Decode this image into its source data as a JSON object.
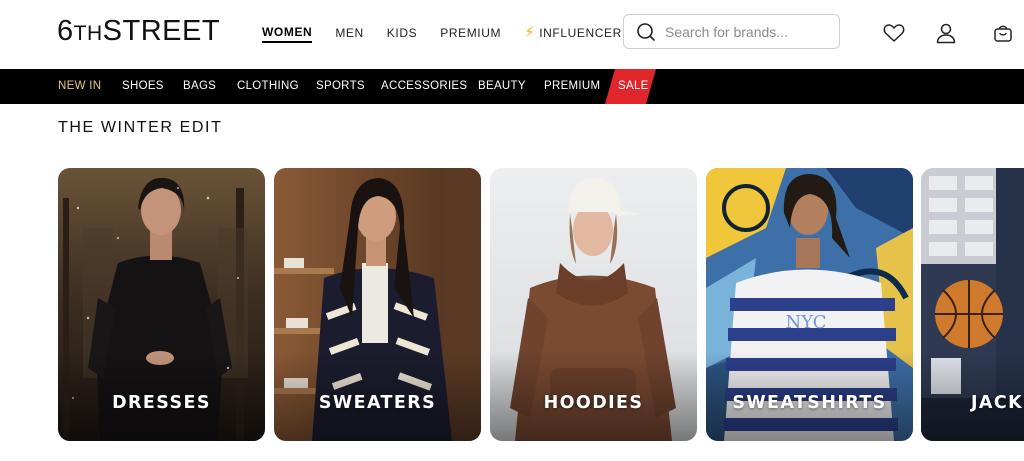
{
  "brand": {
    "logo_big1": "6",
    "logo_small": "TH",
    "logo_big2": "STREET"
  },
  "top_nav": {
    "items": [
      {
        "label": "WOMEN",
        "active": true
      },
      {
        "label": "MEN"
      },
      {
        "label": "KIDS"
      },
      {
        "label": "PREMIUM"
      },
      {
        "label": "INFLUENCER",
        "icon": "lightning-icon"
      }
    ]
  },
  "search": {
    "placeholder": "Search for brands..."
  },
  "header_icons": [
    "heart-icon",
    "user-icon",
    "bag-icon"
  ],
  "category_bar": {
    "items": [
      "NEW IN",
      "SHOES",
      "BAGS",
      "CLOTHING",
      "SPORTS",
      "ACCESSORIES",
      "BEAUTY",
      "PREMIUM",
      "SALE"
    ],
    "new_in_color": "#e8c977",
    "sale_color": "#e0262b"
  },
  "section": {
    "title": "THE WINTER EDIT",
    "cards": [
      {
        "label": "DRESSES"
      },
      {
        "label": "SWEATERS"
      },
      {
        "label": "HOODIES"
      },
      {
        "label": "SWEATSHIRTS"
      },
      {
        "label": "JACKETS"
      }
    ]
  }
}
